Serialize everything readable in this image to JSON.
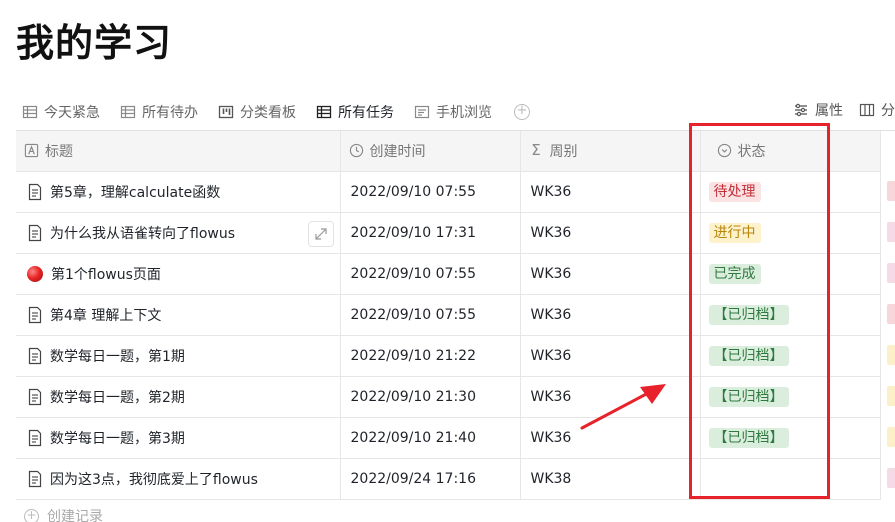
{
  "page_title": "我的学习",
  "views": [
    {
      "label": "今天紧急",
      "icon": "table-icon",
      "active": false
    },
    {
      "label": "所有待办",
      "icon": "table-icon",
      "active": false
    },
    {
      "label": "分类看板",
      "icon": "kanban-icon",
      "active": false
    },
    {
      "label": "所有任务",
      "icon": "table-icon",
      "active": true
    },
    {
      "label": "手机浏览",
      "icon": "list-card-icon",
      "active": false
    }
  ],
  "toolbar": {
    "properties_label": "属性",
    "group_label": "分"
  },
  "columns": [
    {
      "label": "标题",
      "icon": "text-property-icon"
    },
    {
      "label": "创建时间",
      "icon": "clock-icon"
    },
    {
      "label": "周别",
      "icon": "sigma-icon"
    },
    {
      "label": "状态",
      "icon": "select-circle-icon"
    }
  ],
  "rows": [
    {
      "title": "第5章，理解calculate函数",
      "icon": "doc-icon",
      "created": "2022/09/10 07:55",
      "week": "WK36",
      "status": "待处理",
      "status_bg": "#fbe3e4",
      "status_fg": "#c2303a",
      "side_color": "#f7d6dc"
    },
    {
      "title": "为什么我从语雀转向了flowus",
      "icon": "doc-icon",
      "created": "2022/09/10 17:31",
      "week": "WK36",
      "status": "进行中",
      "status_bg": "#fdf2cc",
      "status_fg": "#b8860b",
      "side_color": "#f4dbe6"
    },
    {
      "title": "第1个flowus页面",
      "icon": "red-ball-icon",
      "created": "2022/09/10 07:55",
      "week": "WK36",
      "status": "已完成",
      "status_bg": "#dbeede",
      "status_fg": "#2f7a3e",
      "side_color": "#f4dbe6"
    },
    {
      "title": "第4章 理解上下文",
      "icon": "doc-icon",
      "created": "2022/09/10 07:55",
      "week": "WK36",
      "status": "【已归档】",
      "status_bg": "#dbeede",
      "status_fg": "#2f7a3e",
      "side_color": "#f7d6dc"
    },
    {
      "title": "数学每日一题，第1期",
      "icon": "doc-icon",
      "created": "2022/09/10 21:22",
      "week": "WK36",
      "status": "【已归档】",
      "status_bg": "#dbeede",
      "status_fg": "#2f7a3e",
      "side_color": "#fbf0c8"
    },
    {
      "title": "数学每日一题，第2期",
      "icon": "doc-icon",
      "created": "2022/09/10 21:30",
      "week": "WK36",
      "status": "【已归档】",
      "status_bg": "#dbeede",
      "status_fg": "#2f7a3e",
      "side_color": "#fbf0c8"
    },
    {
      "title": "数学每日一题，第3期",
      "icon": "doc-icon",
      "created": "2022/09/10 21:40",
      "week": "WK36",
      "status": "【已归档】",
      "status_bg": "#dbeede",
      "status_fg": "#2f7a3e",
      "side_color": "#fbf0c8"
    },
    {
      "title": "因为这3点，我彻底爱上了flowus",
      "icon": "doc-icon",
      "created": "2022/09/24 17:16",
      "week": "WK38",
      "status": "",
      "status_bg": "",
      "status_fg": "",
      "side_color": "#f4dbe6"
    }
  ],
  "create_record_label": "创建记录",
  "colors": {
    "annotation_red": "#e8222a",
    "header_bg": "#f5f5f5",
    "active_tab_underline": "#1f2329"
  }
}
